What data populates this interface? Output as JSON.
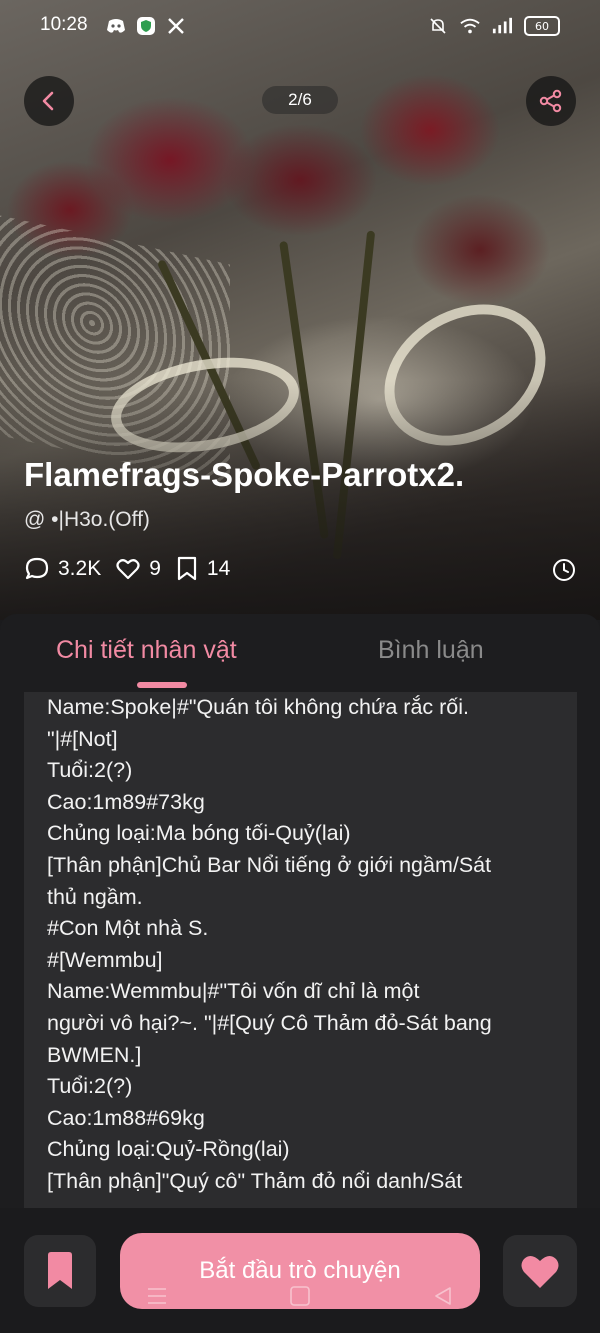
{
  "status_bar": {
    "time": "10:28",
    "battery": "60",
    "left_icons": [
      "discord-icon",
      "shield-app-icon",
      "x-icon"
    ],
    "right_icons": [
      "mute-icon",
      "wifi-icon",
      "signal-icon",
      "battery-icon"
    ]
  },
  "header": {
    "page_indicator": "2/6"
  },
  "character": {
    "title": "Flamefrags-Spoke-Parrotx2.",
    "author": "@ •|H3o.(Off)",
    "comments": "3.2K",
    "likes": "9",
    "bookmarks": "14"
  },
  "tabs": [
    {
      "label": "Chi tiết nhân vật",
      "active": true
    },
    {
      "label": "Bình luận",
      "active": false
    }
  ],
  "description_lines": [
    "Name:Spoke|#\"Quán tôi không chứa rắc rối.",
    "\"|#[Not]",
    "Tuổi:2(?)",
    "Cao:1m89#73kg",
    "Chủng loại:Ma bóng tối-Quỷ(lai)",
    "[Thân phận]Chủ Bar Nổi tiếng ở giới ngầm/Sát",
    "thủ ngầm.",
    "#Con Một nhà S.",
    "#[Wemmbu]",
    "Name:Wemmbu|#\"Tôi vốn dĩ chỉ là một",
    "người vô hại?~. \"|#[Quý Cô Thảm đỏ-Sát bang",
    "BWMEN.]",
    "Tuổi:2(?)",
    "Cao:1m88#69kg",
    "Chủng loại:Quỷ-Rồng(lai)",
    "[Thân phận]\"Quý cô\" Thảm đỏ nổi danh/Sát"
  ],
  "actions": {
    "start_chat": "Bắt đầu trò chuyện"
  },
  "colors": {
    "accent": "#f28aa3",
    "button": "#f190a6",
    "panel": "#1d1d1f",
    "box": "#2c2c2e"
  }
}
